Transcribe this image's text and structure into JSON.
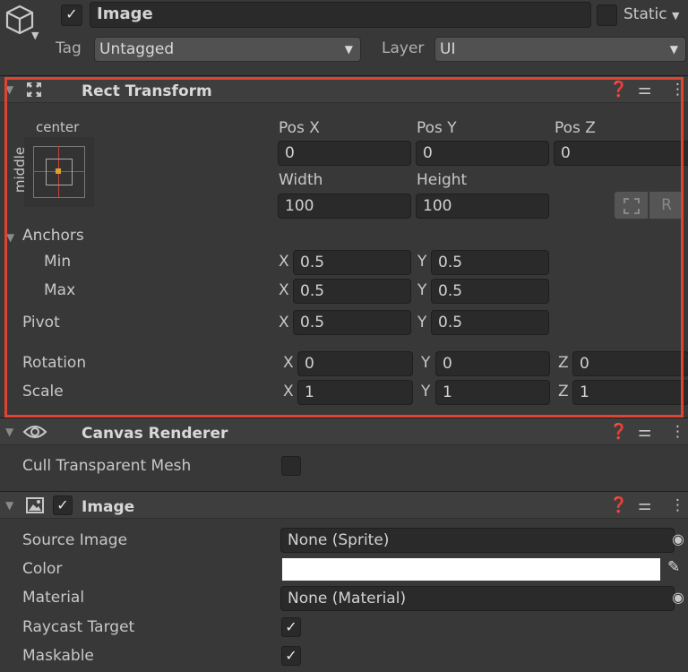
{
  "object": {
    "name": "Image",
    "active": true,
    "static_label": "Static",
    "static": false,
    "tag_label": "Tag",
    "tag": "Untagged",
    "layer_label": "Layer",
    "layer": "UI"
  },
  "rect_transform": {
    "title": "Rect Transform",
    "anchor_h": "center",
    "anchor_v": "middle",
    "pos_x_label": "Pos X",
    "pos_y_label": "Pos Y",
    "pos_z_label": "Pos Z",
    "pos_x": "0",
    "pos_y": "0",
    "pos_z": "0",
    "width_label": "Width",
    "height_label": "Height",
    "width": "100",
    "height": "100",
    "raw_button": "R",
    "anchors_label": "Anchors",
    "min_label": "Min",
    "max_label": "Max",
    "pivot_label": "Pivot",
    "rotation_label": "Rotation",
    "scale_label": "Scale",
    "x": "X",
    "y": "Y",
    "z": "Z",
    "min_x": "0.5",
    "min_y": "0.5",
    "max_x": "0.5",
    "max_y": "0.5",
    "pivot_x": "0.5",
    "pivot_y": "0.5",
    "rot_x": "0",
    "rot_y": "0",
    "rot_z": "0",
    "scale_x": "1",
    "scale_y": "1",
    "scale_z": "1"
  },
  "canvas_renderer": {
    "title": "Canvas Renderer",
    "cull_label": "Cull Transparent Mesh",
    "cull": false
  },
  "image": {
    "title": "Image",
    "enabled": true,
    "source_label": "Source Image",
    "source": "None (Sprite)",
    "color_label": "Color",
    "color": "#ffffff",
    "material_label": "Material",
    "material": "None (Material)",
    "raycast_label": "Raycast Target",
    "raycast": true,
    "maskable_label": "Maskable",
    "maskable": true
  },
  "highlight_color": "#e0432f"
}
